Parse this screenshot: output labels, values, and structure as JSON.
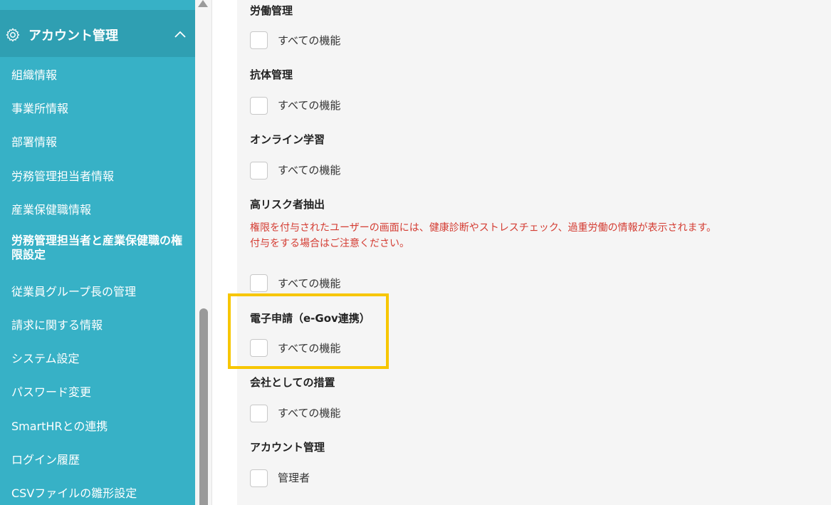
{
  "sidebar": {
    "header": {
      "title": "アカウント管理"
    },
    "items": [
      {
        "label": "組織情報"
      },
      {
        "label": "事業所情報"
      },
      {
        "label": "部署情報"
      },
      {
        "label": "労務管理担当者情報"
      },
      {
        "label": "産業保健職情報"
      },
      {
        "label": "労務管理担当者と産業保健職の権限設定"
      },
      {
        "label": "従業員グループ長の管理"
      },
      {
        "label": "請求に関する情報"
      },
      {
        "label": "システム設定"
      },
      {
        "label": "パスワード変更"
      },
      {
        "label": "SmartHRとの連携"
      },
      {
        "label": "ログイン履歴"
      },
      {
        "label": "CSVファイルの雛形設定"
      }
    ]
  },
  "sections": [
    {
      "title": "労働管理",
      "option": "すべての機能"
    },
    {
      "title": "抗体管理",
      "option": "すべての機能"
    },
    {
      "title": "オンライン学習",
      "option": "すべての機能"
    },
    {
      "title": "高リスク者抽出",
      "warning_line1": "権限を付与されたユーザーの画面には、健康診断やストレスチェック、過重労働の情報が表示されます。",
      "warning_line2": "付与をする場合はご注意ください。",
      "option": "すべての機能"
    },
    {
      "title": "電子申請（e-Gov連携）",
      "option": "すべての機能"
    },
    {
      "title": "会社としての措置",
      "option": "すべての機能"
    },
    {
      "title": "アカウント管理",
      "option": "管理者"
    }
  ],
  "colors": {
    "sidebar_bg": "#37b1c6",
    "sidebar_header_bg": "#2f9fb2",
    "warning_text": "#d43c32",
    "highlight_border": "#f7c600"
  }
}
